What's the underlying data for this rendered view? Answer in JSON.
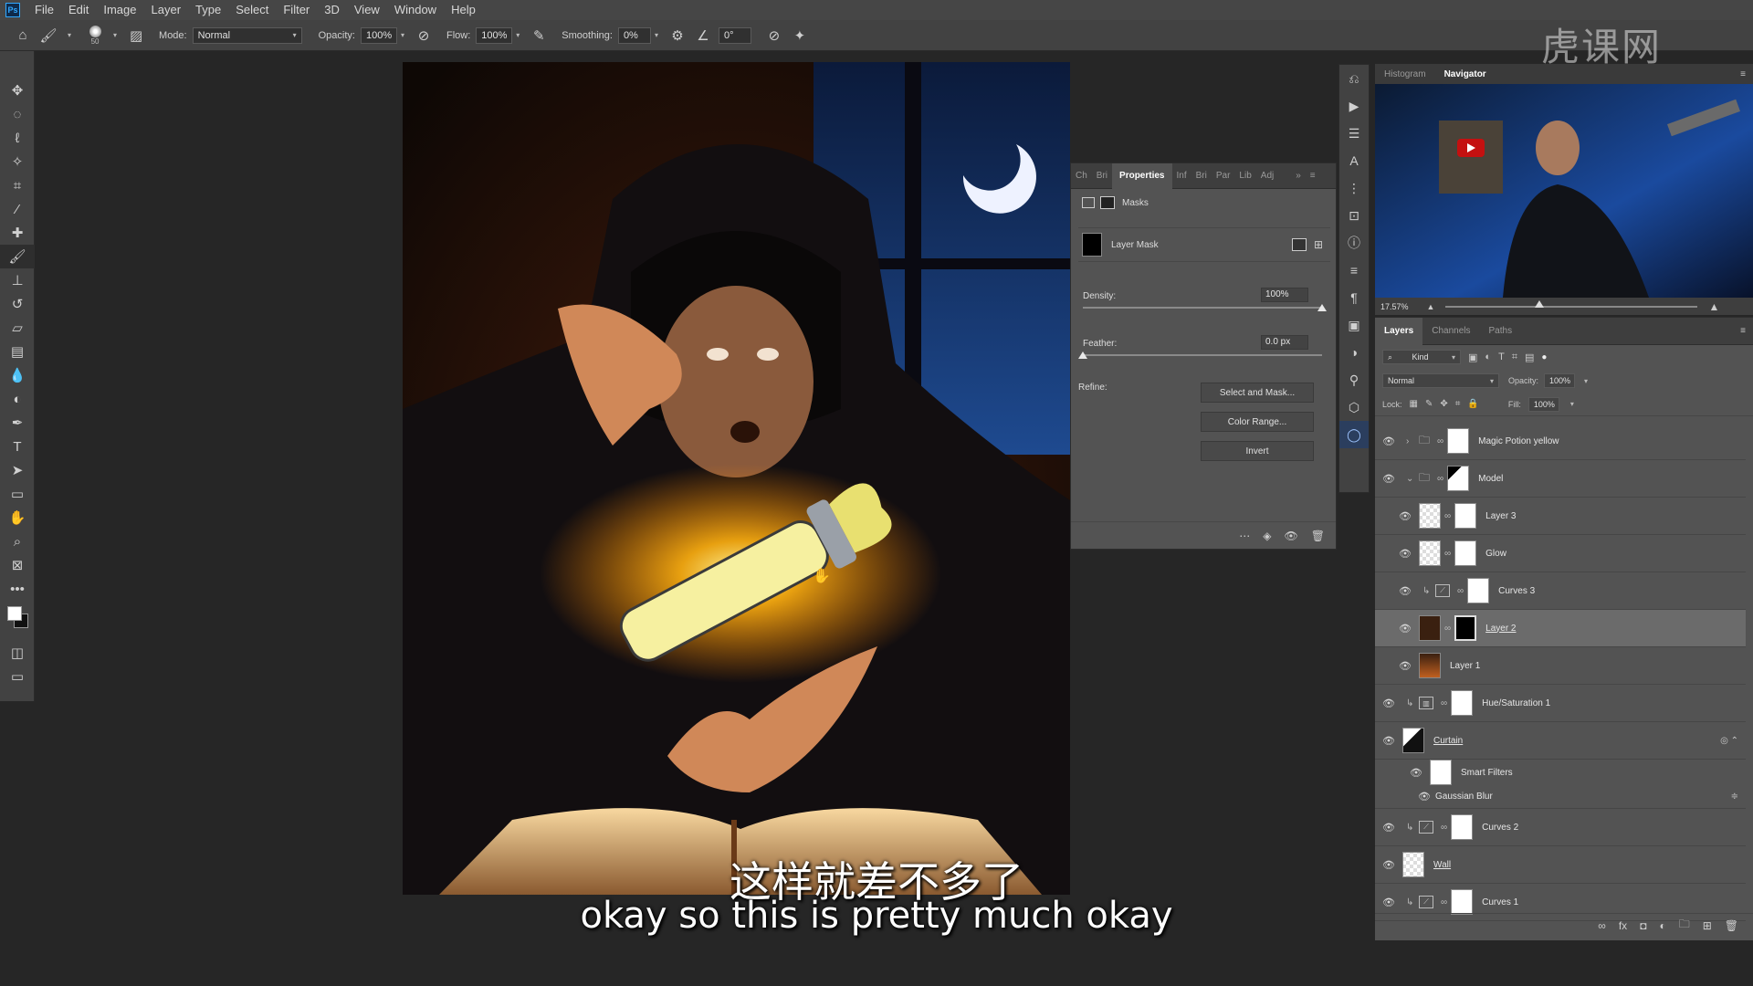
{
  "app": {
    "logo_text": "Ps"
  },
  "menu": [
    "File",
    "Edit",
    "Image",
    "Layer",
    "Type",
    "Select",
    "Filter",
    "3D",
    "View",
    "Window",
    "Help"
  ],
  "options_bar": {
    "brush_size": "50",
    "mode_label": "Mode:",
    "mode_value": "Normal",
    "opacity_label": "Opacity:",
    "opacity_value": "100%",
    "flow_label": "Flow:",
    "flow_value": "100%",
    "smoothing_label": "Smoothing:",
    "smoothing_value": "0%",
    "angle_value": "0°"
  },
  "watermark": "虎课网",
  "properties": {
    "tabs": [
      "Ch",
      "Bri",
      "Properties",
      "Inf",
      "Bri",
      "Par",
      "Lib",
      "Adj"
    ],
    "active_tab": "Properties",
    "section": "Masks",
    "mask_type": "Layer Mask",
    "density_label": "Density:",
    "density_value": "100%",
    "density_level": 1.0,
    "feather_label": "Feather:",
    "feather_value": "0.0 px",
    "feather_level": 0.0,
    "refine_label": "Refine:",
    "buttons": [
      "Select and Mask...",
      "Color Range...",
      "Invert"
    ]
  },
  "navigator": {
    "tabs": [
      "Histogram",
      "Navigator"
    ],
    "active_tab": "Navigator",
    "zoom": "17.57%"
  },
  "layers_panel": {
    "tabs": [
      "Layers",
      "Channels",
      "Paths"
    ],
    "active_tab": "Layers",
    "filter_kind": "Kind",
    "blend_mode": "Normal",
    "opacity_label": "Opacity:",
    "opacity_value": "100%",
    "lock_label": "Lock:",
    "fill_label": "Fill:",
    "fill_value": "100%",
    "layers": [
      {
        "name": "Magic Potion yellow",
        "type": "group"
      },
      {
        "name": "Model",
        "type": "group"
      },
      {
        "name": "Layer 3",
        "type": "layer"
      },
      {
        "name": "Glow",
        "type": "layer"
      },
      {
        "name": "Curves 3",
        "type": "adjustment"
      },
      {
        "name": "Layer 2",
        "type": "layer",
        "selected": true
      },
      {
        "name": "Layer 1",
        "type": "layer"
      },
      {
        "name": "Hue/Saturation 1",
        "type": "adjustment"
      },
      {
        "name": "Curtain",
        "type": "smart-object"
      },
      {
        "name": "Smart Filters",
        "type": "filter-mask"
      },
      {
        "name": "Gaussian Blur",
        "type": "filter"
      },
      {
        "name": "Curves 2",
        "type": "adjustment"
      },
      {
        "name": "Wall",
        "type": "layer"
      },
      {
        "name": "Curves 1",
        "type": "adjustment"
      }
    ]
  },
  "subtitles": {
    "chinese": "这样就差不多了",
    "english": "okay so this is pretty much okay"
  }
}
